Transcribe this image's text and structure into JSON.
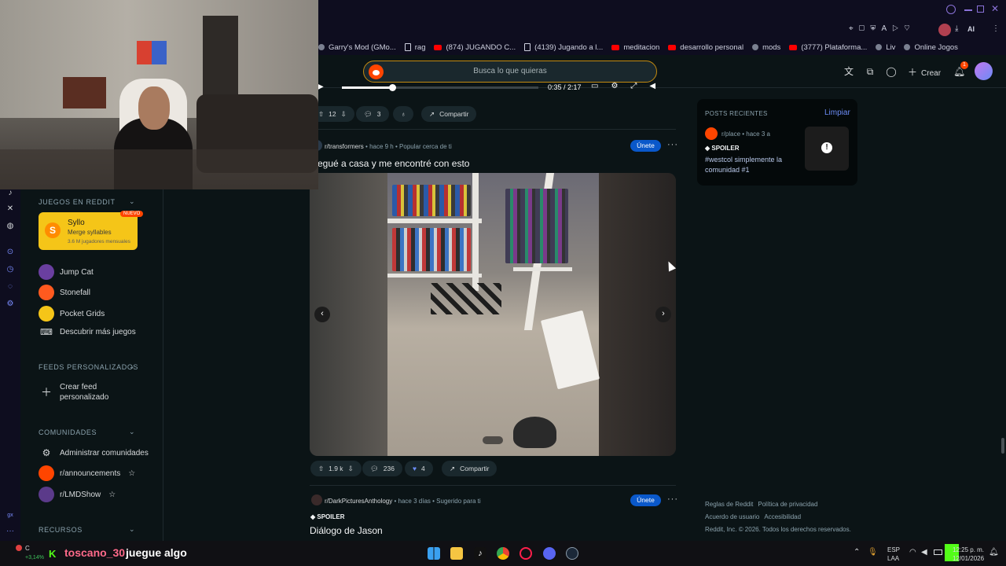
{
  "bookmarks": [
    {
      "label": "Garry's Mod (GMo...",
      "icon": "steam-icon"
    },
    {
      "label": "rag",
      "icon": "document-icon"
    },
    {
      "label": "(874) JUGANDO C...",
      "icon": "youtube-icon"
    },
    {
      "label": "(4139) Jugando a l...",
      "icon": "document-icon"
    },
    {
      "label": "meditacion",
      "icon": "youtube-icon"
    },
    {
      "label": "desarrollo personal",
      "icon": "youtube-icon"
    },
    {
      "label": "mods",
      "icon": "mods-icon"
    },
    {
      "label": "(3777) Plataforma...",
      "icon": "youtube-icon"
    },
    {
      "label": "Liv",
      "icon": "live-icon"
    },
    {
      "label": "Online Jogos",
      "icon": "wifi-icon"
    }
  ],
  "browser": {
    "ai_label": "AI"
  },
  "header": {
    "search_placeholder": "Busca lo que quieras",
    "create_label": "Crear",
    "notif_count": "1"
  },
  "video_bar": {
    "time": "0:35 / 2:17"
  },
  "post0": {
    "upvotes": "12",
    "comments": "3",
    "share": "Compartir"
  },
  "post1": {
    "subreddit": "r/transformers",
    "time": "hace 9 h",
    "reason": "Popular cerca de ti",
    "join": "Únete",
    "title": "egué a casa y me encontré con esto",
    "upvotes": "1.9 k",
    "comments": "236",
    "awards": "4",
    "share": "Compartir"
  },
  "post2": {
    "subreddit": "r/DarkPicturesAnthology",
    "time": "hace 3 días",
    "reason": "Sugerido para ti",
    "join": "Únete",
    "spoiler": "SPOILER",
    "title": "Diálogo de Jason"
  },
  "leftnav": {
    "games_section": "JUEGOS EN REDDIT",
    "featured_game": {
      "title": "Syllo",
      "subtitle": "Merge syllables",
      "users": "3.6 M jugadores mensuales",
      "badge": "NUEVO"
    },
    "games": [
      {
        "label": "Jump Cat",
        "icon": "jump-cat-icon",
        "color": "#6a3fa0"
      },
      {
        "label": "Stonefall",
        "icon": "stonefall-icon",
        "color": "#ff5a1f"
      },
      {
        "label": "Pocket Grids",
        "icon": "pocket-grids-icon",
        "color": "#f5c518"
      }
    ],
    "discover_games": "Descubrir más juegos",
    "feeds_section": "FEEDS PERSONALIZADOS",
    "create_feed": "Crear feed personalizado",
    "communities_section": "COMUNIDADES",
    "manage_communities": "Administrar comunidades",
    "communities": [
      {
        "label": "r/announcements",
        "color": "#ff4500"
      },
      {
        "label": "r/LMDShow",
        "color": "#5b3a8a"
      }
    ],
    "resources_section": "RECURSOS"
  },
  "recent": {
    "title": "POSTS RECIENTES",
    "clear": "Limpiar",
    "item": {
      "subreddit": "r/place",
      "time": "hace 3 a",
      "spoiler": "SPOILER",
      "title": "#westcol simplemente la comunidad #1"
    }
  },
  "footer": {
    "links": [
      "Reglas de Reddit",
      "Política de privacidad",
      "Acuerdo de usuario",
      "Accesibilidad"
    ],
    "copyright": "Reddit, Inc. © 2026. Todos los derechos reservados."
  },
  "taskbar": {
    "stock_change": "+3,14%",
    "stock_letter": "C",
    "stream_user": "toscano_30",
    "stream_message": "juegue algo",
    "lang_top": "ESP",
    "lang_bottom": "LAA",
    "time": "12:25 p. m.",
    "date": "12/01/2026",
    "notif": "1"
  },
  "colors": {
    "accent": "#ff4500",
    "join": "#0a58ca",
    "search_border": "#c38a10",
    "bg": "#0b1416"
  }
}
